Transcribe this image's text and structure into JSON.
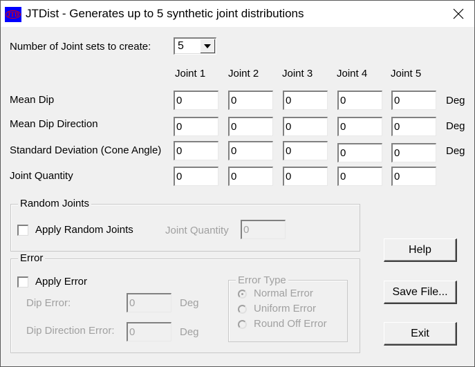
{
  "window": {
    "title": "JTDist - Generates up to 5 synthetic joint distributions",
    "icon_text": "JTD"
  },
  "joint_sets": {
    "label": "Number of Joint sets to create:",
    "selected": "5"
  },
  "columns": [
    "Joint 1",
    "Joint 2",
    "Joint 3",
    "Joint 4",
    "Joint 5"
  ],
  "rows": [
    {
      "label": "Mean Dip",
      "values": [
        "0",
        "0",
        "0",
        "0",
        "0"
      ],
      "unit": "Deg"
    },
    {
      "label": "Mean Dip Direction",
      "values": [
        "0",
        "0",
        "0",
        "0",
        "0"
      ],
      "unit": "Deg"
    },
    {
      "label": "Standard Deviation (Cone Angle)",
      "values": [
        "0",
        "0",
        "0",
        "0",
        "0"
      ],
      "unit": "Deg"
    },
    {
      "label": "Joint Quantity",
      "values": [
        "0",
        "0",
        "0",
        "0",
        "0"
      ],
      "unit": ""
    }
  ],
  "random_joints": {
    "title": "Random Joints",
    "checkbox_label": "Apply Random Joints",
    "checked": false,
    "quantity_label": "Joint Quantity",
    "quantity_value": "0"
  },
  "error": {
    "title": "Error",
    "checkbox_label": "Apply Error",
    "checked": false,
    "dip_error_label": "Dip Error:",
    "dip_error_value": "0",
    "dip_direction_error_label": "Dip Direction Error:",
    "dip_direction_error_value": "0",
    "unit": "Deg",
    "error_type": {
      "title": "Error Type",
      "options": [
        "Normal Error",
        "Uniform Error",
        "Round Off Error"
      ],
      "selected": "Normal Error"
    }
  },
  "buttons": {
    "help": "Help",
    "save": "Save File...",
    "exit": "Exit"
  }
}
